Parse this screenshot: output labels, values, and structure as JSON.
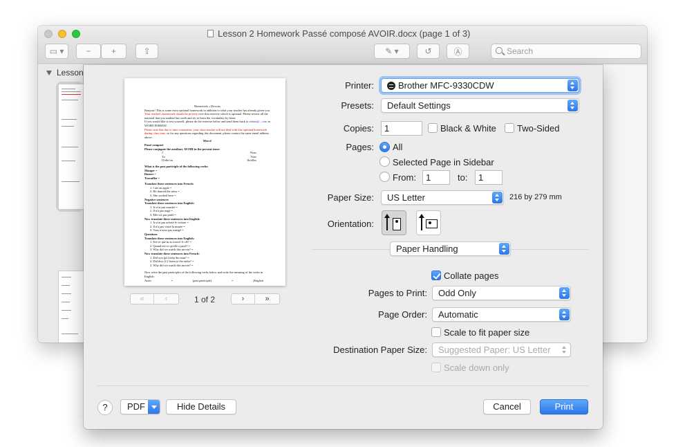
{
  "window": {
    "title": "Lesson 2 Homework Passé composé AVOIR.docx (page 1 of 3)",
    "search_placeholder": "Search",
    "sidebar_label": "Lesson"
  },
  "preview": {
    "title": "Homework « Devoirs",
    "intro1": "Bonjour! This is some extra optional homework in addition to what your teacher has already given you.",
    "intro_red": "Your teacher's homework should be priority",
    "intro2": "over this exercise which is optional. Please review all the material that you studied last week and try to learn the vocabulary by heart.",
    "test1": "If you would like to test yourself, please do the exercise below and send them back to",
    "email": "admin@...com",
    "test2": "in WORD FORMAT.",
    "note_red": "Please note that due to time constraints, your class teacher will not deal with this optional homework during class time,",
    "note2": "so for any questions regarding this document, please contact the same email address above.",
    "merci": "Merci!",
    "section1": "Passé composé",
    "section1b": "Please conjugate the auxiliary AVOIR in the present tense:",
    "conj_left": [
      "J'",
      "Tu",
      "Il/elle/on"
    ],
    "conj_right": [
      "Nous",
      "Vous",
      "Ils/elles"
    ],
    "q_participle": "What is the past participle of the following verbs:",
    "verbs": [
      "Manger =",
      "Danser =",
      "Travailler ="
    ],
    "translate_fr": "Translate these sentences into French:",
    "tr_fr_items": [
      "1. I ate an apple =",
      "2. He danced the salsa =",
      "3. She worked here ="
    ],
    "negative": "Negative sentences",
    "translate_en": "Translate these sentences into English:",
    "tr_en_items": [
      "1. Je n'ai pas marché =",
      "2. Il n'a pas nagé =",
      "3. Elle n'a pas parlé ="
    ],
    "now_fr": "Now translate these sentences into English:",
    "now_fr_items": [
      "1. Je n'ai pas acheté le voiture =",
      "2. Il n'a pas visité la musée =",
      "3. Vous n'avez pas mangé ="
    ],
    "questions": "Questions",
    "q_translate": "Translate these sentences into English:",
    "q_items": [
      "1. Est-ce que tu as trouvé le clé? =",
      "2. Quand est-ce qu'elle a payé? =",
      "3. Why did we watch this movie? ="
    ],
    "now_fr2": "Now translate these sentences into French:",
    "now_fr2_items": [
      "1. Did you (pl.) help the man? =",
      "2. Did they (f.) listen to the radio? =",
      "3. Why did we watch this movie? ="
    ],
    "footer1": "Now write the past participles of the following verbs below and write the meaning of the verbs in English:",
    "footer2": [
      "Avoir",
      "=",
      "(past participle)",
      "=",
      "(English"
    ]
  },
  "pagenav": {
    "first": "«",
    "prev": "‹",
    "count": "1 of 2",
    "next": "›",
    "last": "»"
  },
  "printer": {
    "label": "Printer:",
    "value": "Brother MFC-9330CDW"
  },
  "presets": {
    "label": "Presets:",
    "value": "Default Settings"
  },
  "copies": {
    "label": "Copies:",
    "value": "1",
    "bw": "Black & White",
    "two_sided": "Two-Sided"
  },
  "pages": {
    "label": "Pages:",
    "all": "All",
    "selected": "Selected Page in Sidebar",
    "from_label": "From:",
    "from": "1",
    "to_label": "to:",
    "to": "1"
  },
  "paper_size": {
    "label": "Paper Size:",
    "value": "US Letter",
    "dims": "216 by 279 mm"
  },
  "orientation": {
    "label": "Orientation:"
  },
  "section_popup": "Paper Handling",
  "collate": "Collate pages",
  "pages_to_print": {
    "label": "Pages to Print:",
    "value": "Odd Only"
  },
  "page_order": {
    "label": "Page Order:",
    "value": "Automatic"
  },
  "scale_fit": "Scale to fit paper size",
  "dest_paper": {
    "label": "Destination Paper Size:",
    "value": "Suggested Paper: US Letter"
  },
  "scale_down": "Scale down only",
  "buttons": {
    "help": "?",
    "pdf": "PDF",
    "hide_details": "Hide Details",
    "cancel": "Cancel",
    "print": "Print"
  }
}
